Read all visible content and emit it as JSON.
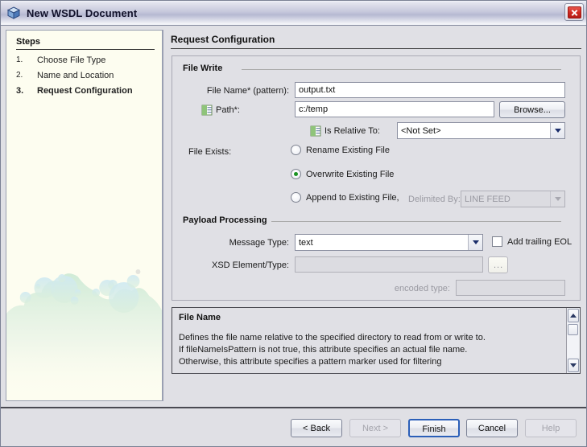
{
  "window": {
    "title": "New WSDL Document",
    "icon": "cube-icon",
    "close_label": "Close"
  },
  "steps": {
    "header": "Steps",
    "items": [
      {
        "num": "1.",
        "label": "Choose File Type",
        "active": false
      },
      {
        "num": "2.",
        "label": "Name and Location",
        "active": false
      },
      {
        "num": "3.",
        "label": "Request Configuration",
        "active": true
      }
    ]
  },
  "main": {
    "heading": "Request Configuration",
    "file_write": {
      "group_title": "File Write",
      "file_name_label": "File Name* (pattern):",
      "file_name_value": "output.txt",
      "path_label": "Path*:",
      "path_value": "c:/temp",
      "browse_label": "Browse...",
      "is_relative_label": "Is Relative To:",
      "is_relative_value": "<Not Set>",
      "file_exists_label": "File Exists:",
      "options": [
        {
          "label": "Rename Existing File",
          "checked": false
        },
        {
          "label": "Overwrite Existing File",
          "checked": true
        },
        {
          "label": "Append to Existing File,",
          "checked": false
        }
      ],
      "delimited_by_label": "Delimited By:",
      "delimited_by_value": "LINE FEED"
    },
    "payload": {
      "group_title": "Payload Processing",
      "message_type_label": "Message Type:",
      "message_type_value": "text",
      "trailing_eol_label": "Add trailing EOL",
      "trailing_eol_checked": false,
      "xsd_label": "XSD Element/Type:",
      "xsd_value": "",
      "xsd_browse_label": "...",
      "encoded_type_label": "encoded type:",
      "encoded_type_value": ""
    }
  },
  "help": {
    "title": "File Name",
    "line1": "Defines the file name relative to the specified directory to read from or write to.",
    "line2": "If fileNameIsPattern is not true, this attribute specifies an actual file name.",
    "line3": "Otherwise, this attribute specifies a pattern marker used for filtering"
  },
  "footer": {
    "back": "< Back",
    "next": "Next >",
    "finish": "Finish",
    "cancel": "Cancel",
    "help": "Help"
  },
  "colors": {
    "titlebar": "#c6c8dc",
    "dialog_bg": "#e0e0e5",
    "steps_bg": "#fdfdf0",
    "radio_selected": "#1a9321",
    "default_button_border": "#2b5fb8",
    "close_button": "#cf2a22"
  }
}
